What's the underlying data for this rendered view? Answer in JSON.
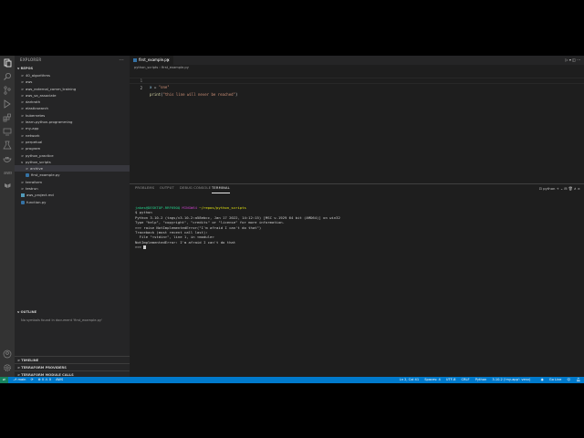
{
  "sidebar": {
    "title": "EXPLORER",
    "more": "···",
    "section": "REPOS",
    "items": [
      {
        "label": "40_algorithms",
        "chev": ">"
      },
      {
        "label": "aws",
        "chev": ">"
      },
      {
        "label": "aws_external_comm_training",
        "chev": ">"
      },
      {
        "label": "aws_sa_associate",
        "chev": ">"
      },
      {
        "label": "darkroth",
        "chev": ">"
      },
      {
        "label": "elasticsearch",
        "chev": ">"
      },
      {
        "label": "kubernetes",
        "chev": ">"
      },
      {
        "label": "learn-python-programming",
        "chev": ">"
      },
      {
        "label": "my-app",
        "chev": ">"
      },
      {
        "label": "network",
        "chev": ">"
      },
      {
        "label": "perpetual",
        "chev": ">"
      },
      {
        "label": "program",
        "chev": ">"
      },
      {
        "label": "python_practice",
        "chev": ">"
      },
      {
        "label": "python_scripts",
        "chev": "v"
      },
      {
        "label": "archive",
        "chev": ">"
      },
      {
        "label": "first_example.py",
        "chev": ""
      },
      {
        "label": "terraform",
        "chev": ">"
      },
      {
        "label": "testrun",
        "chev": ">"
      },
      {
        "label": "aws_project.md",
        "chev": ""
      },
      {
        "label": "function.py",
        "chev": ""
      }
    ],
    "outline_title": "OUTLINE",
    "outline_msg": "No symbols found in document 'first_example.py'",
    "timeline": "TIMELINE",
    "tf_providers": "TERRAFORM PROVIDERS",
    "tf_modules": "TERRAFORM MODULE CALLS"
  },
  "editor": {
    "tab_label": "first_example.py",
    "tab_close": "×",
    "tab_actions": "▷ ▾  ◫  ···",
    "breadcrumb": "python_scripts  ›  first_example.py",
    "lines": [
      {
        "n": "1",
        "var": "x",
        "op": " = ",
        "str": "\"one\"",
        "fn": "",
        "rest": ""
      },
      {
        "n": "2",
        "var": "",
        "op": "",
        "str": "\"this line will never be reached\"",
        "fn": "print",
        "rest": ")"
      }
    ]
  },
  "panel": {
    "tabs": [
      "PROBLEMS",
      "OUTPUT",
      "DEBUG CONSOLE",
      "TERMINAL"
    ],
    "actions": "⊡ python  +  ⌄  ⊟  🗑  ∧  ×",
    "prompt_user": "jakes@DESKTOP-RRFK9OQ",
    "prompt_env": "MINGW64",
    "prompt_path": "~/repos/python_scripts",
    "lines": [
      "$ python",
      "Python 3.10.2 (tags/v3.10.2:a58ebcc, Jan 17 2022, 14:12:15) [MSC v.1929 64 bit (AMD64)] on win32",
      "Type \"help\", \"copyright\", \"credits\" or \"license\" for more information.",
      ">>> raise NotImplementedError(\"I'm afraid I can't do that\")",
      "Traceback (most recent call last):",
      "  File \"<stdin>\", line 1, in <module>",
      "NotImplementedError: I'm afraid I can't do that",
      ">>> "
    ]
  },
  "status": {
    "branch": "main",
    "sync": "⟳",
    "errors": "⊗ 0 ⚠ 0",
    "aws": "AWS",
    "position": "Ln 2, Col 41",
    "spaces": "Spaces: 4",
    "encoding": "UTF-8",
    "eol": "CRLF",
    "language": "Python",
    "interpreter": "3.10.2 ('my-app': venv)",
    "live": "Go Live",
    "colors": {
      "bar": "#007acc",
      "remote": "#16825d"
    }
  }
}
